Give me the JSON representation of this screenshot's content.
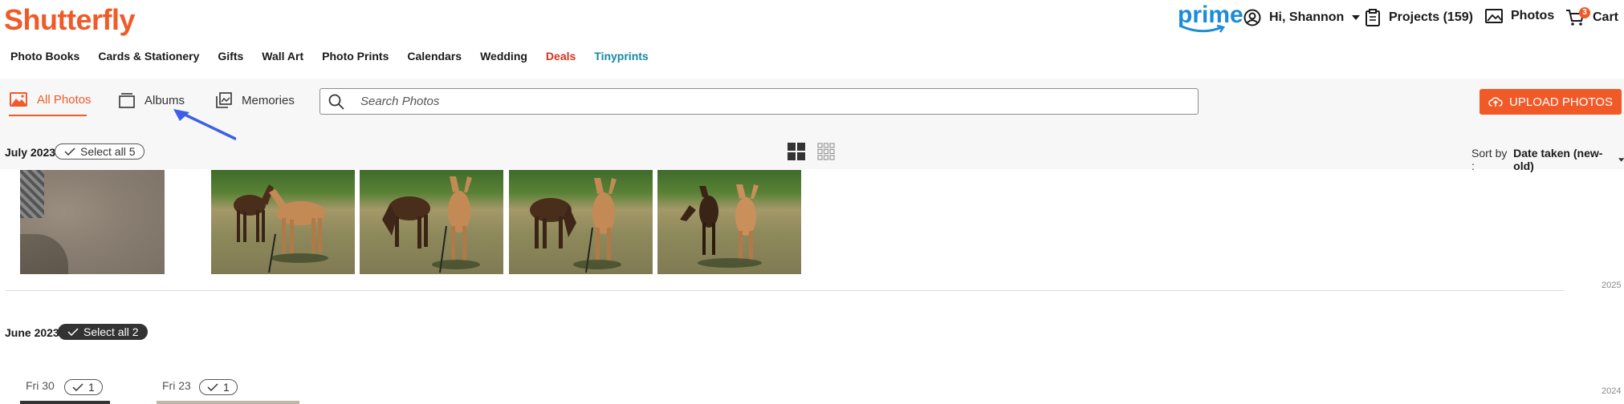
{
  "header": {
    "logo": "Shutterfly",
    "prime": "prime",
    "greeting": "Hi, Shannon",
    "projects": "Projects (159)",
    "photos": "Photos",
    "cart": "Cart",
    "cart_count": "3"
  },
  "nav": {
    "items": [
      "Photo Books",
      "Cards & Stationery",
      "Gifts",
      "Wall Art",
      "Photo Prints",
      "Calendars",
      "Wedding",
      "Deals",
      "Tinyprints"
    ]
  },
  "toolbar": {
    "tabs": [
      "All Photos",
      "Albums",
      "Memories"
    ],
    "search_placeholder": "Search Photos",
    "upload_label": "UPLOAD PHOTOS"
  },
  "groups": {
    "july": {
      "label": "July 2023",
      "select": "Select all 5"
    },
    "june": {
      "label": "June 2023",
      "select": "Select all 2"
    }
  },
  "sort": {
    "label": "Sort by :",
    "value": "Date taken (new-old)"
  },
  "years": [
    "2025",
    "2024"
  ],
  "days": [
    {
      "label": "Fri 30",
      "count": "1"
    },
    {
      "label": "Fri 23",
      "count": "1"
    }
  ],
  "colors": {
    "brand": "#f05a28",
    "prime": "#1a8cd8",
    "deals": "#d5321d",
    "tinyprints": "#1787a5"
  }
}
